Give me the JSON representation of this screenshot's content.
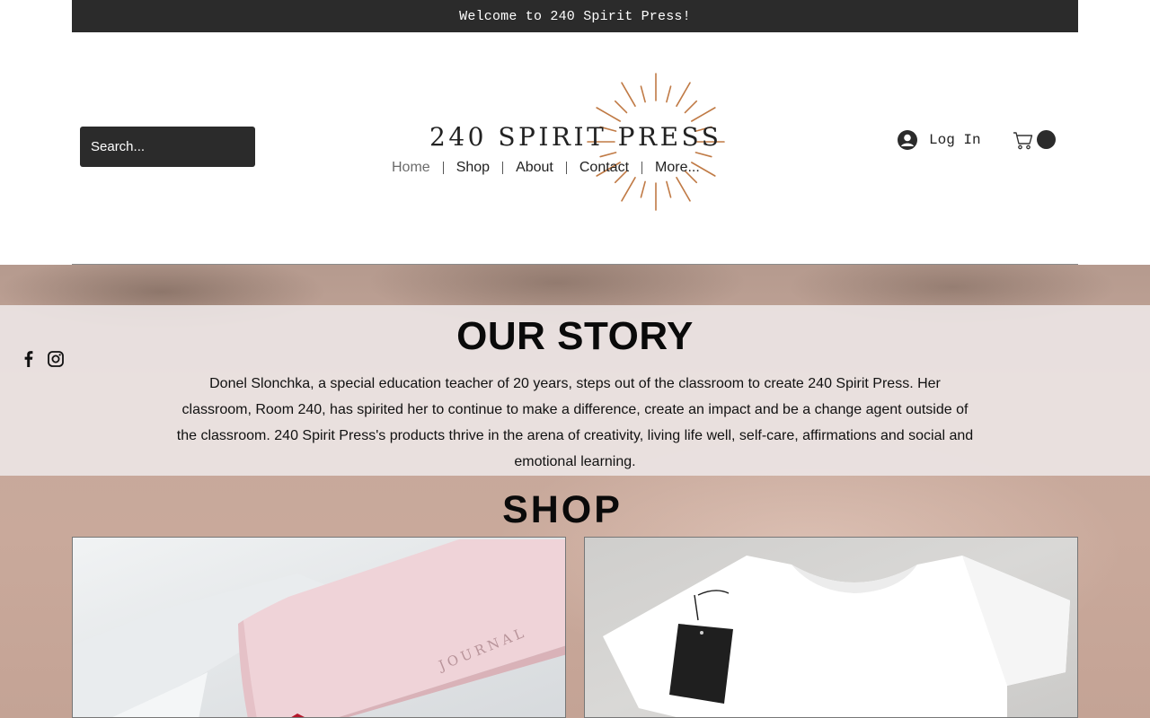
{
  "announcement": "Welcome to 240 Spirit Press!",
  "search": {
    "placeholder": "Search..."
  },
  "brand": {
    "name": "240 SPIRIT PRESS",
    "accent": "#c07a45"
  },
  "nav": {
    "home": "Home",
    "shop": "Shop",
    "about": "About",
    "contact": "Contact",
    "more": "More..."
  },
  "account": {
    "login_label": "Log In"
  },
  "cart": {
    "count": ""
  },
  "story": {
    "title": "OUR STORY",
    "body": "Donel Slonchka, a special education teacher of 20 years, steps out of the classroom to create 240 Spirit Press.   Her classroom, Room 240, has spirited her to continue to make a difference, create an impact and be a change agent outside of the classroom. 240 Spirit Press's products thrive in the arena of creativity, living life well, self-care, affirmations and social and emotional learning."
  },
  "shop": {
    "title": "SHOP",
    "cards": [
      {
        "name": "journal",
        "embossed_text": "JOURNAL"
      },
      {
        "name": "t-shirt"
      }
    ]
  },
  "social": {
    "icons": [
      "facebook-icon",
      "instagram-icon"
    ]
  },
  "colors": {
    "dark": "#2b2b2b",
    "hero_bg": "#c6a89b",
    "panel": "#ece6e5"
  }
}
